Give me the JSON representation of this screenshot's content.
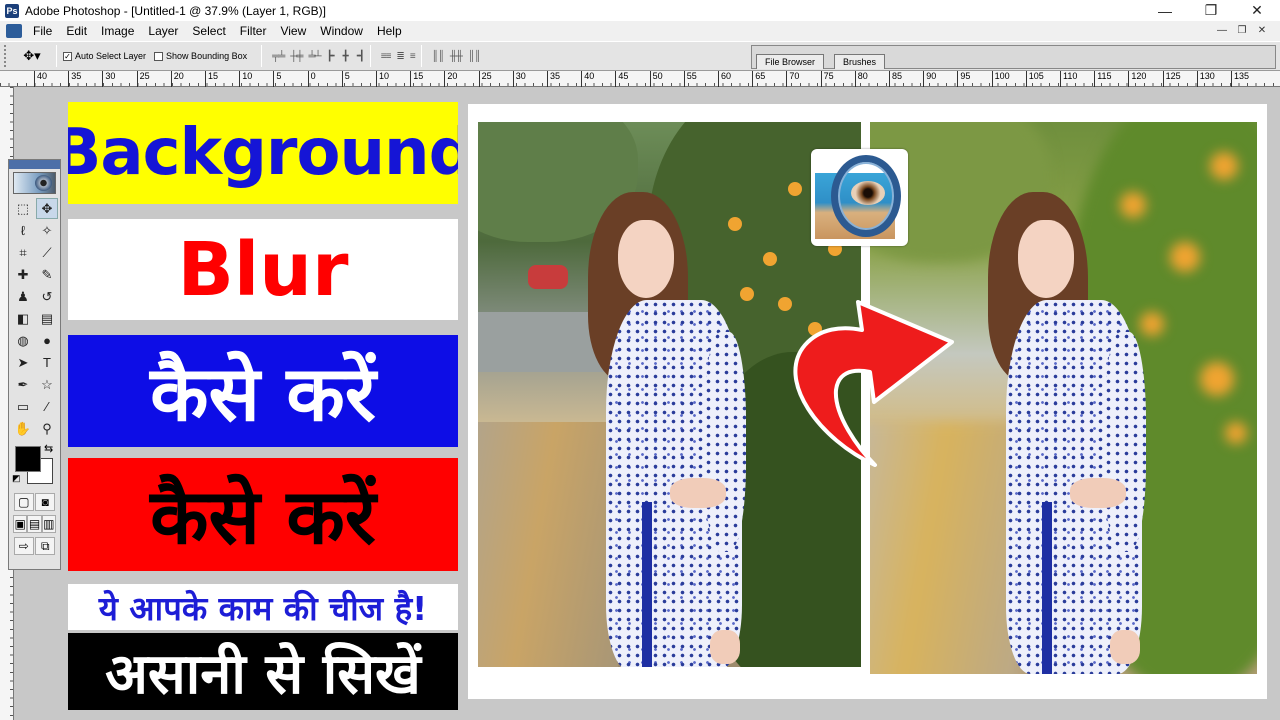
{
  "window": {
    "title": "Adobe Photoshop - [Untitled-1 @ 37.9% (Layer 1, RGB)]",
    "controls": {
      "minimize": "—",
      "restore": "❐",
      "close": "✕"
    }
  },
  "menu": {
    "items": [
      "File",
      "Edit",
      "Image",
      "Layer",
      "Select",
      "Filter",
      "View",
      "Window",
      "Help"
    ]
  },
  "options": {
    "auto_select_label": "Auto Select Layer",
    "auto_select_checked": true,
    "bounding_box_label": "Show Bounding Box",
    "bounding_box_checked": false,
    "palette_tabs": [
      "File Browser",
      "Brushes"
    ]
  },
  "ruler": {
    "h_ticks": [
      "40",
      "35",
      "30",
      "25",
      "20",
      "15",
      "10",
      "5",
      "0",
      "5",
      "10",
      "15",
      "20",
      "25",
      "30",
      "35",
      "40",
      "45",
      "50",
      "55",
      "60",
      "65",
      "70",
      "75",
      "80",
      "85",
      "90",
      "95",
      "100",
      "105",
      "110",
      "115",
      "120",
      "125",
      "130",
      "135"
    ]
  },
  "toolbox": {
    "tools": [
      {
        "name": "marquee-tool-icon",
        "glyph": "⬚"
      },
      {
        "name": "move-tool-icon",
        "glyph": "✥"
      },
      {
        "name": "lasso-tool-icon",
        "glyph": "ℓ"
      },
      {
        "name": "magic-wand-icon",
        "glyph": "✧"
      },
      {
        "name": "crop-tool-icon",
        "glyph": "⌗"
      },
      {
        "name": "slice-tool-icon",
        "glyph": "⟋"
      },
      {
        "name": "healing-brush-icon",
        "glyph": "✚"
      },
      {
        "name": "brush-tool-icon",
        "glyph": "✎"
      },
      {
        "name": "clone-stamp-icon",
        "glyph": "♟"
      },
      {
        "name": "history-brush-icon",
        "glyph": "↺"
      },
      {
        "name": "eraser-tool-icon",
        "glyph": "◧"
      },
      {
        "name": "gradient-tool-icon",
        "glyph": "▤"
      },
      {
        "name": "blur-tool-icon",
        "glyph": "◍"
      },
      {
        "name": "dodge-tool-icon",
        "glyph": "●"
      },
      {
        "name": "path-select-icon",
        "glyph": "➤"
      },
      {
        "name": "type-tool-icon",
        "glyph": "T"
      },
      {
        "name": "pen-tool-icon",
        "glyph": "✒"
      },
      {
        "name": "shape-tool-icon",
        "glyph": "☆"
      },
      {
        "name": "notes-tool-icon",
        "glyph": "▭"
      },
      {
        "name": "eyedropper-icon",
        "glyph": "⁄"
      },
      {
        "name": "hand-tool-icon",
        "glyph": "✋"
      },
      {
        "name": "zoom-tool-icon",
        "glyph": "⚲"
      }
    ],
    "swap_glyph": "⇆",
    "default_glyph": "◩",
    "mask_modes": [
      "▢",
      "◙"
    ],
    "screen_modes": [
      "▣",
      "▤",
      "▥"
    ],
    "jump_glyphs": [
      "⇨",
      "⧉"
    ]
  },
  "banners": {
    "line1": "Background",
    "line2": "Blur",
    "line3": "कैसे करें",
    "line4": "कैसे करें",
    "line5": "ये आपके काम की चीज है!",
    "line6": "असानी से सिखें"
  },
  "colors": {
    "accent_yellow": "#ffff00",
    "accent_blue": "#0d0de6",
    "accent_red": "#ff0000",
    "arrow_red": "#ee1c1c"
  }
}
